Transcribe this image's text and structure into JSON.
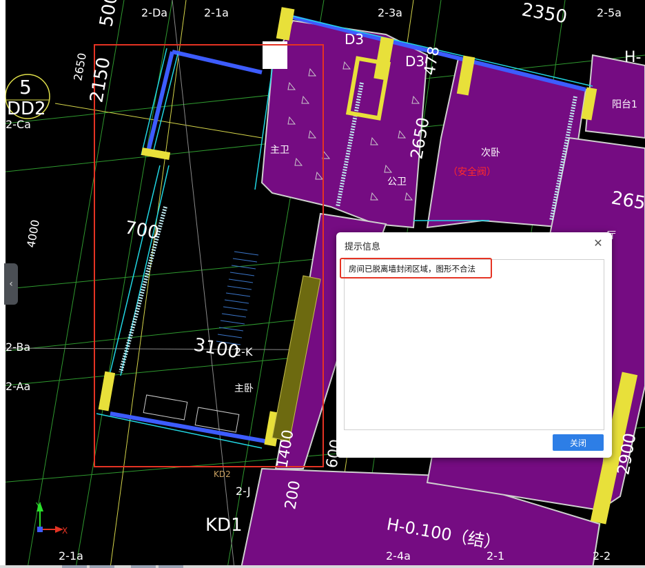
{
  "dialog": {
    "title": "提示信息",
    "message": "房间已脱离墙封闭区域，图形不合法",
    "close_button": "关闭"
  },
  "drawing": {
    "axis_labels": {
      "top": [
        "2-Da",
        "2-1a",
        "2-3a",
        "2-5a"
      ],
      "left": [
        "2-Ca",
        "2-Ba",
        "2-Aa"
      ],
      "bottom": [
        "2-1a",
        "2-4a",
        "2-1",
        "2-2"
      ],
      "mid": [
        "2-K",
        "2-J"
      ]
    },
    "dimensions": [
      "500",
      "2150",
      "2650",
      "4000",
      "700",
      "3100",
      "2350",
      "2650",
      "265",
      "2900",
      "1400",
      "200",
      "600",
      "5",
      "478"
    ],
    "room_labels": [
      "主卫",
      "公卫",
      "次卧",
      "主卧",
      "阳台1",
      "厅"
    ],
    "annotation_red": "（安全阀）",
    "tags": [
      "D3",
      "D3",
      "KD1",
      "KD2",
      "H-0.100（结）",
      "DD2",
      "H-"
    ],
    "ucs": {
      "y": "Y",
      "x": "X"
    },
    "side_handle": "‹"
  }
}
